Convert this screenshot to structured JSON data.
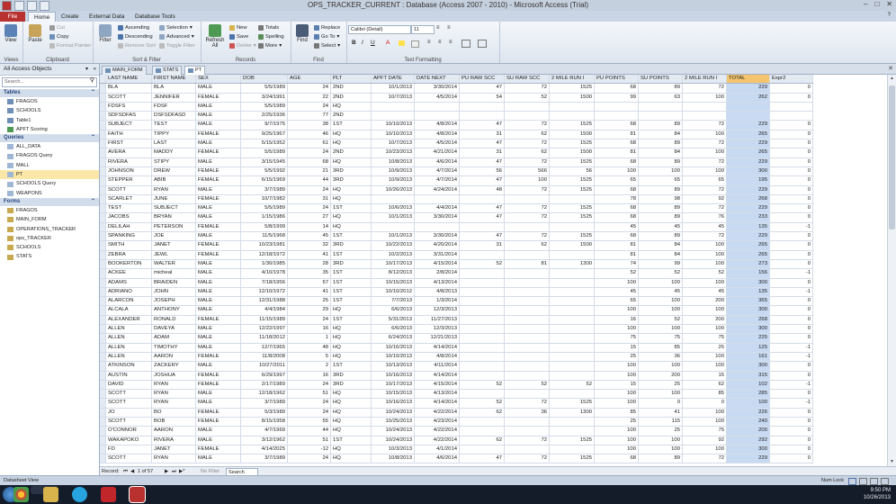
{
  "window": {
    "title": "OPS_TRACKER_CURRENT : Database (Access 2007 - 2010) - Microsoft Access (Trial)"
  },
  "ribbon": {
    "tabs": [
      "File",
      "Home",
      "Create",
      "External Data",
      "Database Tools"
    ],
    "groups": {
      "views": {
        "label": "Views",
        "view": "View"
      },
      "clipboard": {
        "label": "Clipboard",
        "paste": "Paste",
        "cut": "Cut",
        "copy": "Copy",
        "format_painter": "Format Painter"
      },
      "sort_filter": {
        "label": "Sort & Filter",
        "filter": "Filter",
        "ascending": "Ascending",
        "descending": "Descending",
        "remove_sort": "Remove Sort",
        "selection": "Selection",
        "advanced": "Advanced",
        "toggle_filter": "Toggle Filter"
      },
      "records": {
        "label": "Records",
        "refresh": "Refresh All",
        "new": "New",
        "save": "Save",
        "delete": "Delete",
        "totals": "Totals",
        "spelling": "Spelling",
        "more": "More"
      },
      "find": {
        "label": "Find",
        "find": "Find",
        "replace": "Replace",
        "goto": "Go To",
        "select": "Select"
      },
      "text_formatting": {
        "label": "Text Formatting",
        "font": "Calibri (Detail)",
        "size": "11"
      }
    }
  },
  "nav_pane": {
    "header": "All Access Objects",
    "search_placeholder": "Search...",
    "sections": [
      {
        "title": "Tables",
        "items": [
          "FRAGOS",
          "SCHOOLS",
          "Table1",
          "APFT Scoring"
        ]
      },
      {
        "title": "Queries",
        "items": [
          "ALL_DATA",
          "FRAGOS Query",
          "MALL",
          "PT",
          "SCHOOLS Query",
          "WEAPONS"
        ]
      },
      {
        "title": "Forms",
        "items": [
          "FRAGOS",
          "MAIN_FORM",
          "OPERATIONS_TRACKER",
          "ops_TRACKER",
          "SCHOOLS",
          "STATS"
        ]
      }
    ],
    "selected": "PT"
  },
  "doc_tabs": [
    "MAIN_FORM",
    "STATS",
    "PT"
  ],
  "grid": {
    "columns": [
      "LAST NAME",
      "FIRST NAME",
      "SEX",
      "DOB",
      "AGE",
      "PLT",
      "APFT DATE",
      "DATE NEXT",
      "PU RAW SCC",
      "SU RAW SCC",
      "2 MILE RUN I",
      "PU POINTS",
      "SU POINTS",
      "2 MILE RUN I",
      "TOTAL",
      "Expr2"
    ],
    "rows": [
      [
        "BLA",
        "BLA",
        "MALE",
        "5/5/1989",
        "24",
        "2ND",
        "10/1/2013",
        "3/30/2014",
        "47",
        "72",
        "1525",
        "68",
        "89",
        "72",
        "229",
        "0"
      ],
      [
        "SCOTT",
        "JENNIFER",
        "FEMALE",
        "3/24/1991",
        "22",
        "2ND",
        "10/7/2013",
        "4/5/2014",
        "54",
        "52",
        "1500",
        "99",
        "63",
        "100",
        "262",
        "0"
      ],
      [
        "FDSFS",
        "FDSF",
        "MALE",
        "5/5/1989",
        "24",
        "HQ",
        "",
        "",
        "",
        "",
        "",
        "",
        "",
        "",
        "",
        ""
      ],
      [
        "SDFSDFAS",
        "DSFSDFASD",
        "MALE",
        "2/25/1936",
        "77",
        "2ND",
        "",
        "",
        "",
        "",
        "",
        "",
        "",
        "",
        "",
        ""
      ],
      [
        "SUBJECT",
        "TEST",
        "MALE",
        "9/7/1975",
        "38",
        "1ST",
        "10/10/2013",
        "4/8/2014",
        "47",
        "72",
        "1525",
        "68",
        "89",
        "72",
        "229",
        "0"
      ],
      [
        "FAITH",
        "TIPPY",
        "FEMALE",
        "9/25/1967",
        "46",
        "HQ",
        "10/10/2013",
        "4/8/2014",
        "31",
        "62",
        "1500",
        "81",
        "84",
        "100",
        "265",
        "0"
      ],
      [
        "FIRST",
        "LAST",
        "MALE",
        "5/15/1952",
        "61",
        "HQ",
        "10/7/2013",
        "4/5/2014",
        "47",
        "72",
        "1525",
        "68",
        "89",
        "72",
        "229",
        "0"
      ],
      [
        "AVERA",
        "MADDY",
        "FEMALE",
        "5/5/1989",
        "24",
        "2ND",
        "10/23/2013",
        "4/21/2014",
        "31",
        "62",
        "1500",
        "81",
        "84",
        "100",
        "265",
        "0"
      ],
      [
        "RIVERA",
        "STIPY",
        "MALE",
        "3/15/1945",
        "68",
        "HQ",
        "10/8/2013",
        "4/6/2014",
        "47",
        "72",
        "1525",
        "68",
        "89",
        "72",
        "229",
        "0"
      ],
      [
        "JOHNSON",
        "DREW",
        "FEMALE",
        "5/5/1992",
        "21",
        "3RD",
        "10/9/2013",
        "4/7/2014",
        "56",
        "566",
        "56",
        "100",
        "100",
        "100",
        "300",
        "0"
      ],
      [
        "STEPPER",
        "ABIB",
        "FEMALE",
        "6/15/1969",
        "44",
        "3RD",
        "10/9/2013",
        "4/7/2014",
        "47",
        "100",
        "1525",
        "65",
        "65",
        "65",
        "195",
        "0"
      ],
      [
        "SCOTT",
        "RYAN",
        "MALE",
        "3/7/1989",
        "24",
        "HQ",
        "10/26/2013",
        "4/24/2014",
        "48",
        "72",
        "1525",
        "68",
        "89",
        "72",
        "229",
        "0"
      ],
      [
        "SCARLET",
        "JUNE",
        "FEMALE",
        "10/7/1982",
        "31",
        "HQ",
        "",
        "",
        "",
        "",
        "",
        "78",
        "98",
        "92",
        "268",
        "0"
      ],
      [
        "TEST",
        "SUBJECT",
        "MALE",
        "5/5/1989",
        "24",
        "1ST",
        "10/6/2013",
        "4/4/2014",
        "47",
        "72",
        "1525",
        "68",
        "89",
        "72",
        "229",
        "0"
      ],
      [
        "JACOBS",
        "BRYAN",
        "MALE",
        "1/15/1986",
        "27",
        "HQ",
        "10/1/2013",
        "3/30/2014",
        "47",
        "72",
        "1525",
        "68",
        "89",
        "76",
        "233",
        "0"
      ],
      [
        "DELILAH",
        "PETERSON",
        "FEMALE",
        "5/8/1999",
        "14",
        "HQ",
        "",
        "",
        "",
        "",
        "",
        "45",
        "45",
        "45",
        "135",
        "-1"
      ],
      [
        "SPANKING",
        "JOE",
        "MALE",
        "11/5/1968",
        "45",
        "1ST",
        "10/1/2013",
        "3/30/2014",
        "47",
        "72",
        "1525",
        "68",
        "89",
        "72",
        "229",
        "0"
      ],
      [
        "SMITH",
        "JANET",
        "FEMALE",
        "10/23/1981",
        "32",
        "3RD",
        "10/22/2013",
        "4/20/2014",
        "31",
        "62",
        "1500",
        "81",
        "84",
        "100",
        "265",
        "0"
      ],
      [
        "ZEBRA",
        "JEWL",
        "FEMALE",
        "12/18/1972",
        "41",
        "1ST",
        "10/2/2013",
        "3/31/2014",
        "",
        "",
        "",
        "81",
        "84",
        "100",
        "265",
        "0"
      ],
      [
        "BOOKERTON",
        "WALTER",
        "MALE",
        "1/30/1985",
        "28",
        "3RD",
        "10/17/2013",
        "4/15/2014",
        "52",
        "81",
        "1300",
        "74",
        "99",
        "100",
        "273",
        "0"
      ],
      [
        "ACKEE",
        "micheal",
        "MALE",
        "4/10/1978",
        "35",
        "1ST",
        "8/12/2013",
        "2/8/2014",
        "",
        "",
        "",
        "52",
        "52",
        "52",
        "156",
        "-1"
      ],
      [
        "ADAMS",
        "BRAIDEN",
        "MALE",
        "7/18/1956",
        "57",
        "1ST",
        "10/15/2013",
        "4/13/2014",
        "",
        "",
        "",
        "100",
        "100",
        "100",
        "300",
        "0"
      ],
      [
        "ADRIANO",
        "JOHN",
        "MALE",
        "12/10/1972",
        "41",
        "1ST",
        "10/10/2012",
        "4/8/2013",
        "",
        "",
        "",
        "45",
        "45",
        "45",
        "135",
        "-1"
      ],
      [
        "ALARCON",
        "JOSEPH",
        "MALE",
        "12/31/1988",
        "25",
        "1ST",
        "7/7/2013",
        "1/3/2014",
        "",
        "",
        "",
        "65",
        "100",
        "200",
        "365",
        "0"
      ],
      [
        "ALCALA",
        "ANTHONY",
        "MALE",
        "4/4/1984",
        "29",
        "HQ",
        "6/6/2013",
        "12/3/2013",
        "",
        "",
        "",
        "100",
        "100",
        "100",
        "300",
        "0"
      ],
      [
        "ALEXANDER",
        "RONALD",
        "FEMALE",
        "11/15/1989",
        "24",
        "1ST",
        "5/31/2013",
        "11/27/2013",
        "",
        "",
        "",
        "16",
        "52",
        "200",
        "268",
        "0"
      ],
      [
        "ALLEN",
        "DAVEYA",
        "MALE",
        "12/22/1997",
        "16",
        "HQ",
        "6/6/2013",
        "12/3/2013",
        "",
        "",
        "",
        "100",
        "100",
        "100",
        "300",
        "0"
      ],
      [
        "ALLEN",
        "ADAM",
        "MALE",
        "11/18/2012",
        "1",
        "HQ",
        "6/24/2013",
        "12/21/2013",
        "",
        "",
        "",
        "75",
        "75",
        "75",
        "225",
        "0"
      ],
      [
        "ALLEN",
        "TIMOTHY",
        "MALE",
        "12/7/1965",
        "48",
        "HQ",
        "10/16/2013",
        "4/14/2014",
        "",
        "",
        "",
        "15",
        "85",
        "25",
        "125",
        "-1"
      ],
      [
        "ALLEN",
        "AARON",
        "FEMALE",
        "11/8/2008",
        "5",
        "HQ",
        "10/10/2013",
        "4/8/2014",
        "",
        "",
        "",
        "25",
        "36",
        "100",
        "161",
        "-1"
      ],
      [
        "ATKINSON",
        "ZACKERY",
        "MALE",
        "10/27/2011",
        "2",
        "1ST",
        "10/13/2013",
        "4/11/2014",
        "",
        "",
        "",
        "100",
        "100",
        "100",
        "300",
        "0"
      ],
      [
        "AUSTIN",
        "JOSHUA",
        "FEMALE",
        "6/29/1997",
        "16",
        "3RD",
        "10/16/2013",
        "4/14/2014",
        "",
        "",
        "",
        "100",
        "200",
        "15",
        "315",
        "0"
      ],
      [
        "DAVID",
        "RYAN",
        "FEMALE",
        "2/17/1989",
        "24",
        "3RD",
        "10/17/2013",
        "4/15/2014",
        "52",
        "52",
        "52",
        "15",
        "25",
        "62",
        "102",
        "-1"
      ],
      [
        "SCOTT",
        "RYAN",
        "MALE",
        "12/18/1962",
        "51",
        "HQ",
        "10/15/2013",
        "4/13/2014",
        "",
        "",
        "",
        "100",
        "100",
        "85",
        "285",
        "0"
      ],
      [
        "SCOTT",
        "RYAN",
        "MALE",
        "3/7/1989",
        "24",
        "HQ",
        "10/16/2013",
        "4/14/2014",
        "52",
        "72",
        "1525",
        "100",
        "0",
        "0",
        "100",
        "-1"
      ],
      [
        "JO",
        "BO",
        "FEMALE",
        "5/3/1989",
        "24",
        "HQ",
        "10/24/2013",
        "4/22/2014",
        "62",
        "36",
        "1300",
        "85",
        "41",
        "100",
        "226",
        "0"
      ],
      [
        "SCOTT",
        "BOB",
        "FEMALE",
        "8/15/1958",
        "55",
        "HQ",
        "10/25/2013",
        "4/23/2014",
        "",
        "",
        "",
        "25",
        "115",
        "100",
        "240",
        "0"
      ],
      [
        "O'CONNOR",
        "AARON",
        "MALE",
        "4/7/1969",
        "44",
        "HQ",
        "10/24/2013",
        "4/22/2014",
        "",
        "",
        "",
        "100",
        "25",
        "75",
        "200",
        "0"
      ],
      [
        "WAKAPOKO",
        "RIVERA",
        "MALE",
        "3/12/1962",
        "51",
        "1ST",
        "10/24/2013",
        "4/22/2014",
        "62",
        "72",
        "1525",
        "100",
        "100",
        "92",
        "292",
        "0"
      ],
      [
        "FD",
        "JANET",
        "FEMALE",
        "4/14/2025",
        "-12",
        "HQ",
        "10/3/2013",
        "4/1/2014",
        "",
        "",
        "",
        "100",
        "100",
        "100",
        "300",
        "0"
      ],
      [
        "SCOTT",
        "RYAN",
        "MALE",
        "3/7/1989",
        "24",
        "HQ",
        "10/8/2013",
        "4/6/2014",
        "47",
        "72",
        "1525",
        "68",
        "89",
        "72",
        "229",
        "0"
      ]
    ]
  },
  "record_nav": {
    "label": "Record:",
    "position": "1 of 57",
    "filter": "No Filter",
    "search": "Search"
  },
  "status": {
    "left": "Datasheet View",
    "right": "Num Lock"
  },
  "taskbar": {
    "time": "9:50 PM",
    "date": "10/26/2013"
  },
  "colors": {
    "accent": "#b8312f",
    "selected_column": "#c7daf2",
    "header_bg": "#e4eaf2"
  }
}
